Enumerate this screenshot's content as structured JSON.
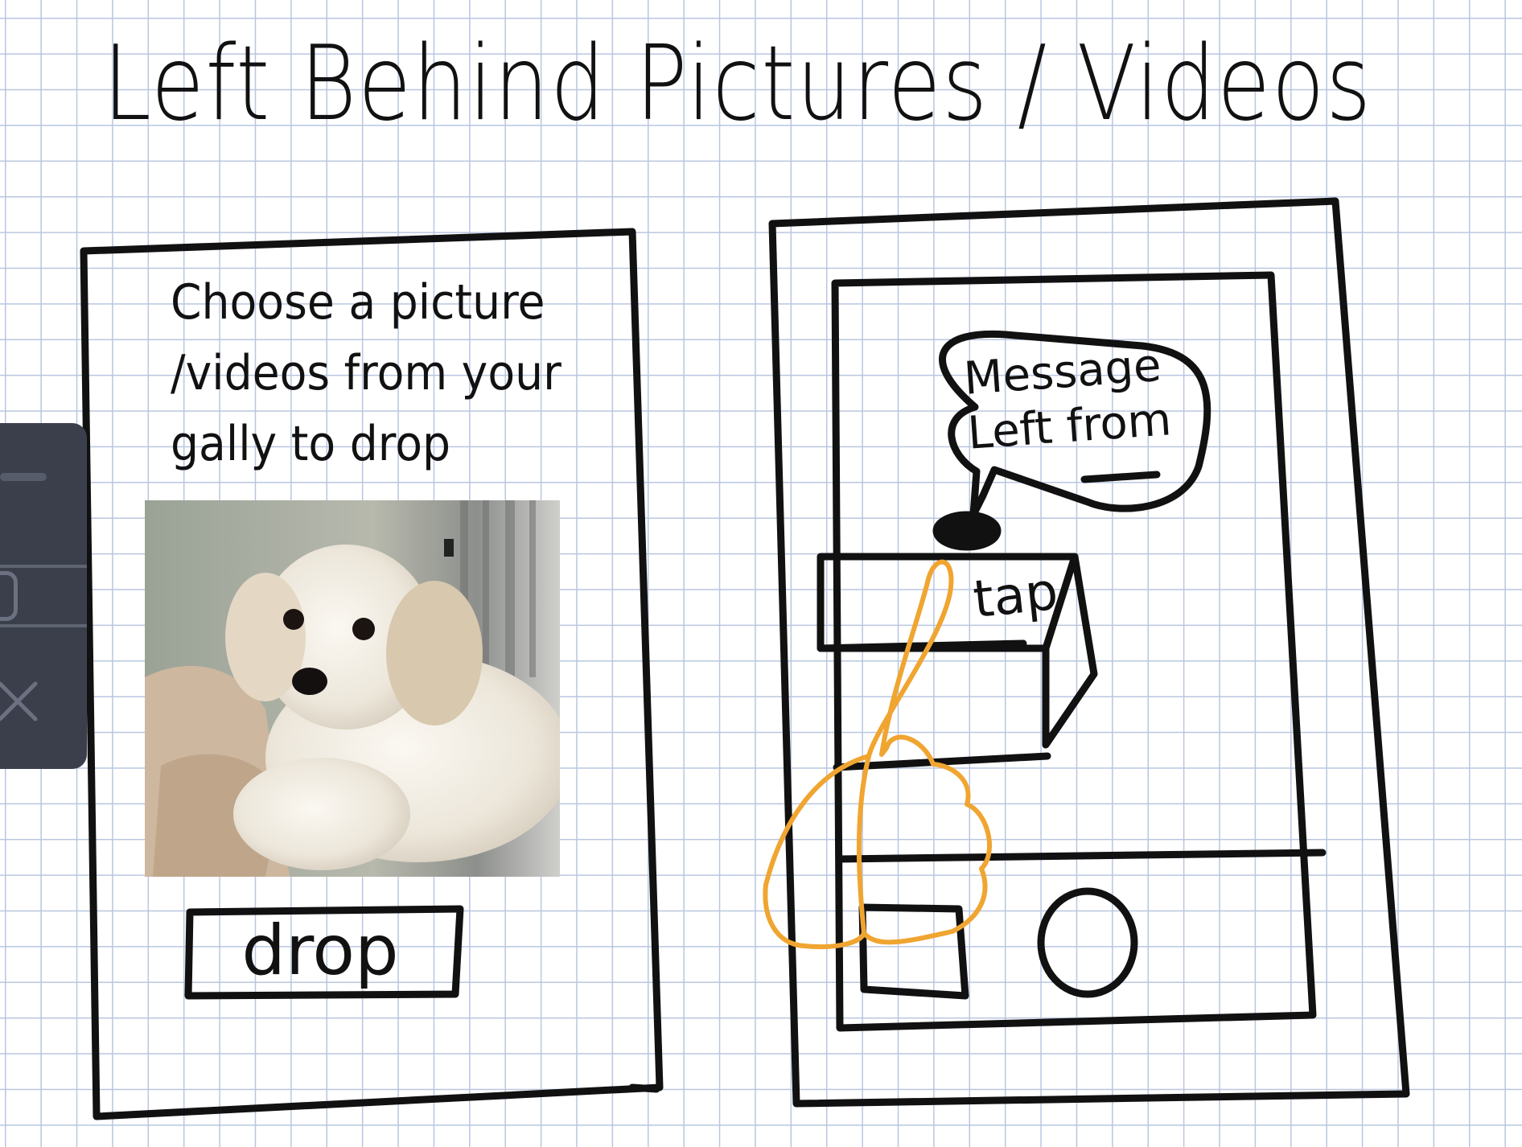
{
  "title": "Left Behind  Pictures / Videos",
  "left_phone": {
    "prompt_lines": [
      "Choose a picture",
      "/videos from your",
      "gally to drop"
    ],
    "drop_button_label": "drop"
  },
  "right_phone": {
    "bubble_lines": [
      "Message",
      "Left from"
    ],
    "tap_label": "tap"
  },
  "colors": {
    "ink": "#111111",
    "gesture": "#f0a531",
    "grid": "#b9c6e0",
    "toolbar": "#3a3f4b"
  },
  "icons": [
    "pointing-hand-icon",
    "close-icon"
  ]
}
